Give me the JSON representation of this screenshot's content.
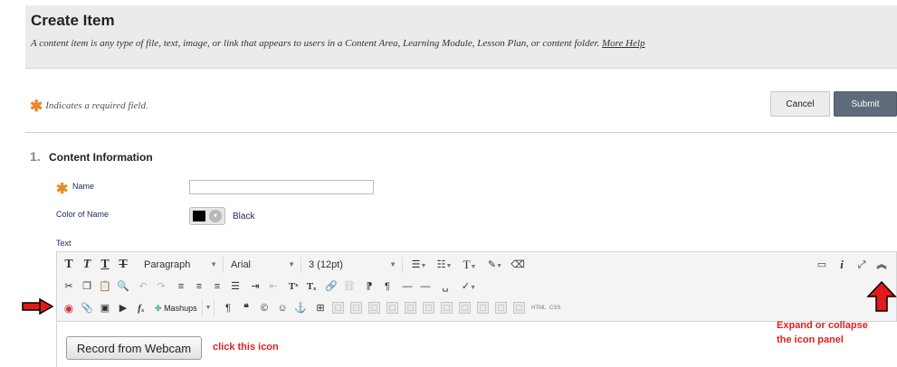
{
  "header": {
    "title": "Create Item",
    "description": "A content item is any type of file, text, image, or link that appears to users in a Content Area, Learning Module, Lesson Plan, or content folder.",
    "more_help": "More Help"
  },
  "required_note": "Indicates a required field.",
  "actions": {
    "cancel": "Cancel",
    "submit": "Submit"
  },
  "section": {
    "number": "1.",
    "title": "Content Information",
    "name_label": "Name",
    "name_value": "",
    "color_label": "Color of Name",
    "color_value": "Black",
    "color_hex": "#000000",
    "text_label": "Text"
  },
  "editor": {
    "format_select": "Paragraph",
    "font_select": "Arial",
    "size_select": "3 (12pt)",
    "mashups_label": "Mashups",
    "html_label": "HTML",
    "css_label": "CSS"
  },
  "record_button": "Record from Webcam",
  "annotations": {
    "click_note": "click this icon",
    "expand_line1": "Expand or collapse",
    "expand_line2": "the icon panel",
    "arrow_color": "#e01b1b"
  }
}
